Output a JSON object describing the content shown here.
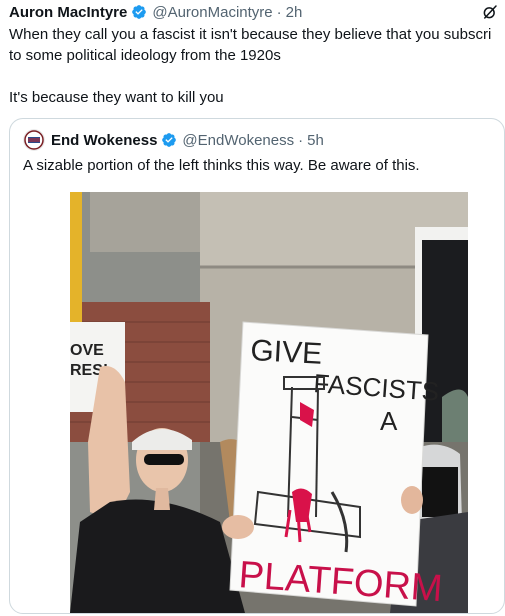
{
  "tweet": {
    "author_name": "Auron MacIntyre",
    "author_handle": "@AuronMacintyre",
    "separator": "·",
    "time": "2h",
    "lines": [
      "When they call you a fascist it isn't because they believe that you subscri",
      "to some political ideology from the 1920s",
      "",
      "It's because they want to kill you"
    ],
    "icons": {
      "verified": "verified-badge-icon",
      "grok": "grok-icon"
    },
    "colors": {
      "verified": "#1d9bf0",
      "secondary_text": "#536471",
      "border": "#cfd9de"
    }
  },
  "quoted": {
    "author_name": "End Wokeness",
    "author_handle": "@EndWokeness",
    "separator": "·",
    "time": "5h",
    "text": "A sizable portion of the left thinks this way. Be aware of this.",
    "photo": {
      "sign_lines": [
        "GIVE",
        "FASCISTS",
        "A",
        "PLATFORM"
      ],
      "left_sign_lines": [
        "OVE",
        "RES!"
      ]
    }
  }
}
